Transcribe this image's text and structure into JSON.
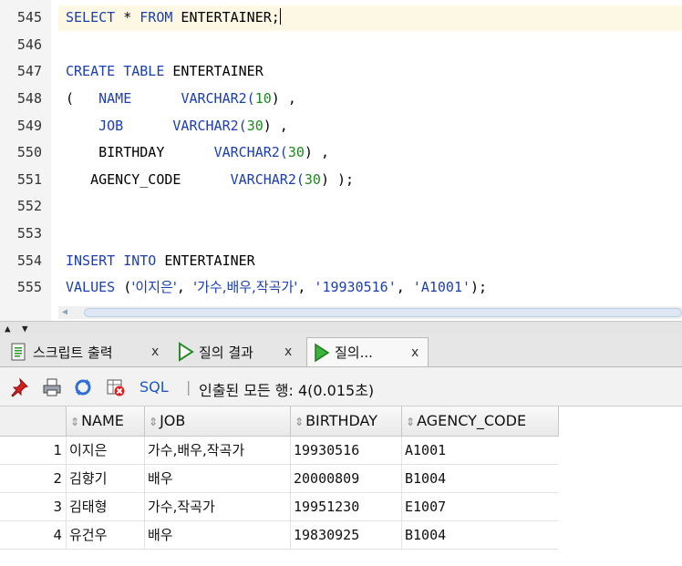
{
  "editor": {
    "lines": [
      {
        "num": "545"
      },
      {
        "num": "546"
      },
      {
        "num": "547"
      },
      {
        "num": "548"
      },
      {
        "num": "549"
      },
      {
        "num": "550"
      },
      {
        "num": "551"
      },
      {
        "num": "552"
      },
      {
        "num": "553"
      },
      {
        "num": "554"
      },
      {
        "num": "555"
      }
    ],
    "code": {
      "l545_kw1": "SELECT",
      "l545_star": " * ",
      "l545_kw2": "FROM",
      "l545_rest": " ENTERTAINER;",
      "l547_kw1": "CREATE",
      "l547_kw2": "TABLE",
      "l547_rest": " ENTERTAINER",
      "l548_open": "(",
      "l548_col": "NAME",
      "l548_type": "VARCHAR2(",
      "l548_num": "10",
      "l548_end": ") ,",
      "l549_col": "JOB",
      "l549_type": "VARCHAR2(",
      "l549_num": "30",
      "l549_end": ") ,",
      "l550_col": "BIRTHDAY",
      "l550_type": "VARCHAR2(",
      "l550_num": "30",
      "l550_end": ") ,",
      "l551_col": "AGENCY_CODE",
      "l551_type": "VARCHAR2(",
      "l551_num": "30",
      "l551_end": ") );",
      "l554_kw1": "INSERT",
      "l554_kw2": "INTO",
      "l554_rest": " ENTERTAINER",
      "l555_kw": "VALUES",
      "l555_open": " (",
      "l555_s1": "'이지은'",
      "l555_s2": "'가수,배우,작곡가'",
      "l555_s3": "'19930516'",
      "l555_s4": "'A1001'",
      "l555_sep": ", ",
      "l555_end": ");"
    }
  },
  "tabs": [
    {
      "label": "스크립트 출력",
      "close": "x",
      "icon": "script-output-icon"
    },
    {
      "label": "질의 결과",
      "close": "x",
      "icon": "run-query-icon"
    },
    {
      "label": "질의...",
      "close": "x",
      "icon": "run-query-icon"
    }
  ],
  "toolbar": {
    "sql_label": "SQL",
    "separator": "|",
    "status": "인출된 모든 행: 4(0.015초)"
  },
  "grid": {
    "columns": [
      "NAME",
      "JOB",
      "BIRTHDAY",
      "AGENCY_CODE"
    ],
    "rows": [
      {
        "n": "1",
        "name": "이지은",
        "job": "가수,배우,작곡가",
        "birthday": "19930516",
        "agency": "A1001"
      },
      {
        "n": "2",
        "name": "김향기",
        "job": "배우",
        "birthday": "20000809",
        "agency": "B1004"
      },
      {
        "n": "3",
        "name": "김태형",
        "job": "가수,작곡가",
        "birthday": "19951230",
        "agency": "E1007"
      },
      {
        "n": "4",
        "name": "유건우",
        "job": "배우",
        "birthday": "19830925",
        "agency": "B1004"
      }
    ]
  },
  "colors": {
    "keyword": "#1b3eb3",
    "number": "#1b8a1b",
    "current_line": "#fdf8e4"
  }
}
